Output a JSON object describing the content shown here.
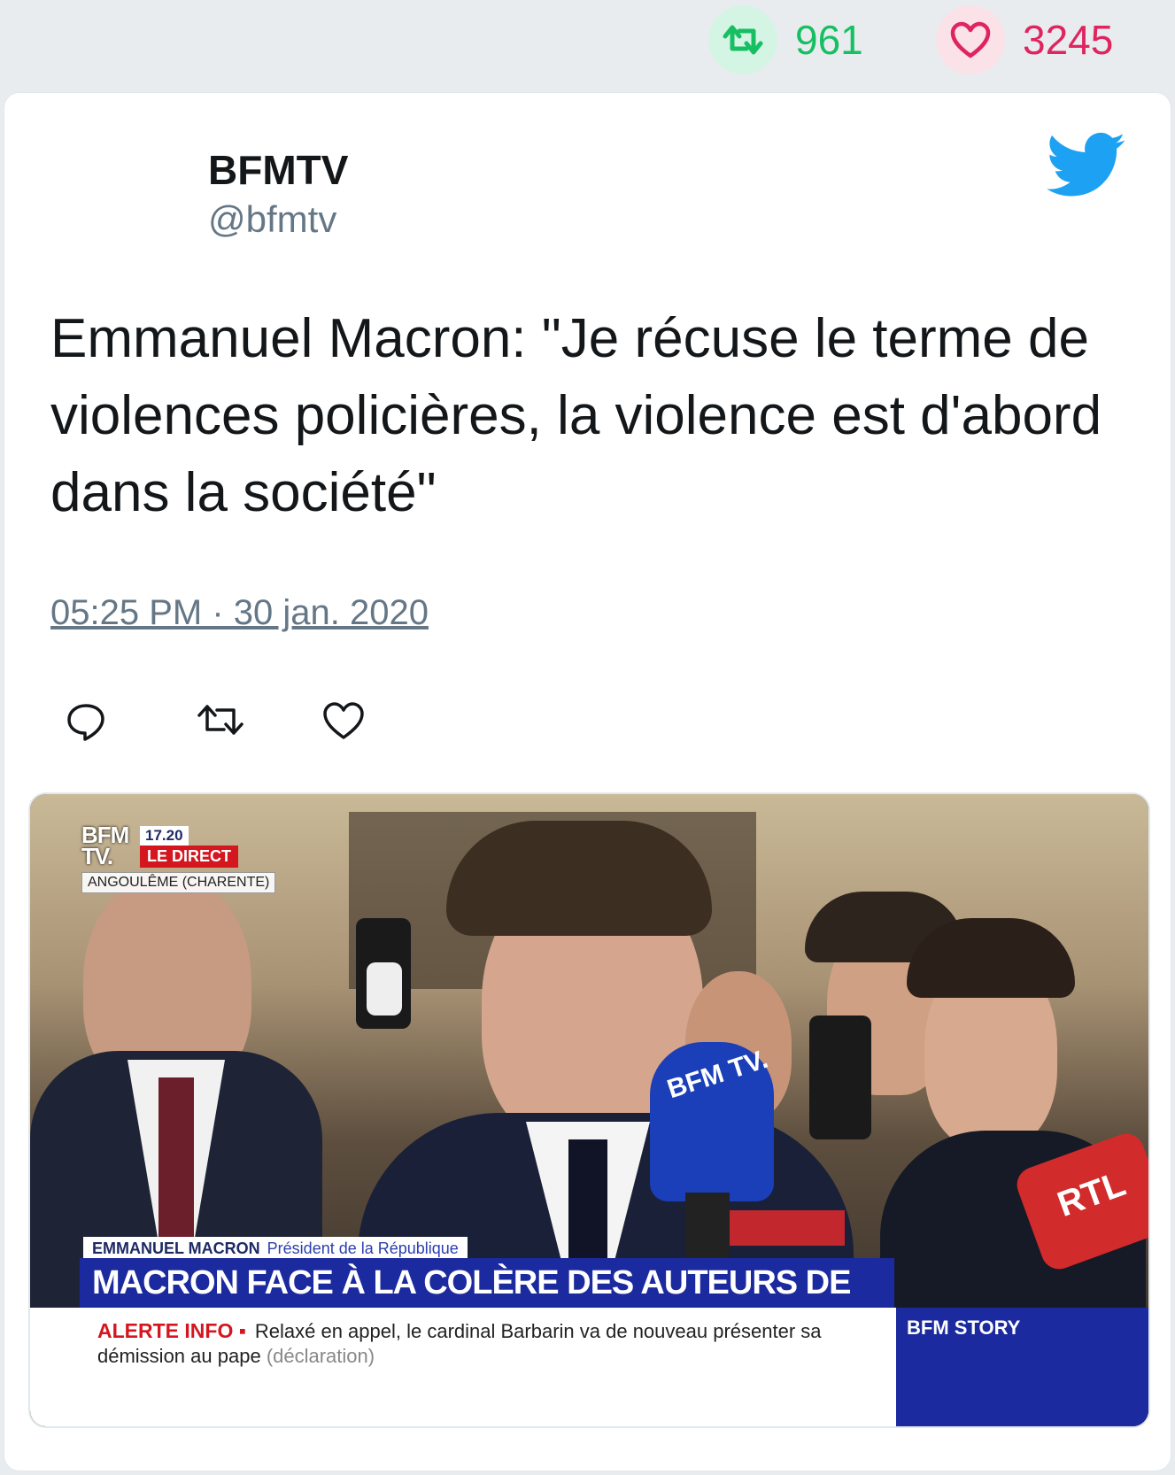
{
  "stats": {
    "retweets": "961",
    "likes": "3245",
    "retweet_color": "#17bf63",
    "like_color": "#e0245e"
  },
  "author": {
    "name": "BFMTV",
    "handle": "@bfmtv"
  },
  "tweet": {
    "text": "Emmanuel Macron: \"Je récuse le terme de violences policières, la violence est d'abord dans la société\"",
    "timestamp": "05:25 PM · 30 jan. 2020"
  },
  "actions": {
    "icons": [
      "reply-icon",
      "retweet-icon",
      "like-icon"
    ]
  },
  "media": {
    "channel_logo_line1": "BFM",
    "channel_logo_line2": "TV.",
    "time": "17.20",
    "live_label": "LE DIRECT",
    "location": "ANGOULÊME (CHARENTE)",
    "speaker_name": "EMMANUEL MACRON",
    "speaker_title": "Président de la République",
    "headline": "MACRON FACE À LA COLÈRE DES AUTEURS DE BD",
    "alert_label": "ALERTE INFO ▪",
    "alert_text": "Relaxé en appel, le cardinal Barbarin va de nouveau présenter sa démission au pape",
    "alert_suffix": "(déclaration)",
    "story_label": "BFM STORY",
    "mic_label": "BFM TV.",
    "mic2_label": "RTL"
  }
}
